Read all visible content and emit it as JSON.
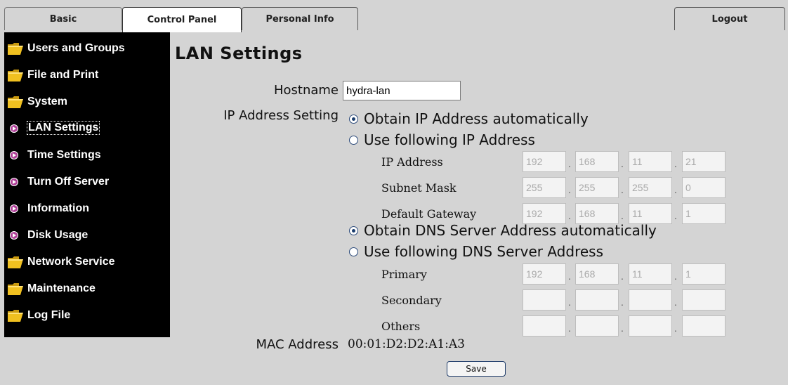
{
  "tabs": {
    "basic": "Basic",
    "control_panel": "Control Panel",
    "personal_info": "Personal Info",
    "logout": "Logout"
  },
  "sidebar": {
    "items": [
      {
        "label": "Users and Groups",
        "icon": "folder-icon"
      },
      {
        "label": "File and Print",
        "icon": "folder-icon"
      },
      {
        "label": "System",
        "icon": "folder-open-icon"
      },
      {
        "label": "LAN Settings",
        "icon": "arrow-bullet-icon"
      },
      {
        "label": "Time Settings",
        "icon": "arrow-bullet-icon"
      },
      {
        "label": "Turn Off Server",
        "icon": "arrow-bullet-icon"
      },
      {
        "label": "Information",
        "icon": "arrow-bullet-icon"
      },
      {
        "label": "Disk Usage",
        "icon": "arrow-bullet-icon"
      },
      {
        "label": "Network Service",
        "icon": "folder-icon"
      },
      {
        "label": "Maintenance",
        "icon": "folder-icon"
      },
      {
        "label": "Log File",
        "icon": "folder-icon"
      }
    ]
  },
  "main": {
    "title": "LAN Settings",
    "hostname_label": "Hostname",
    "hostname_value": "hydra-lan",
    "ip_setting_label": "IP Address Setting",
    "ip_options": [
      {
        "label": "Obtain IP Address automatically",
        "checked": true
      },
      {
        "label": "Use following IP Address",
        "checked": false
      }
    ],
    "ip_fields": [
      {
        "label": "IP Address",
        "octets": [
          "192",
          "168",
          "11",
          "21"
        ]
      },
      {
        "label": "Subnet Mask",
        "octets": [
          "255",
          "255",
          "255",
          "0"
        ]
      },
      {
        "label": "Default Gateway",
        "octets": [
          "192",
          "168",
          "11",
          "1"
        ]
      }
    ],
    "dns_options": [
      {
        "label": "Obtain DNS Server Address automatically",
        "checked": true
      },
      {
        "label": "Use following DNS Server Address",
        "checked": false
      }
    ],
    "dns_fields": [
      {
        "label": "Primary",
        "octets": [
          "192",
          "168",
          "11",
          "1"
        ]
      },
      {
        "label": "Secondary",
        "octets": [
          "",
          "",
          "",
          ""
        ]
      },
      {
        "label": "Others",
        "octets": [
          "",
          "",
          "",
          ""
        ]
      }
    ],
    "mac_label": "MAC Address",
    "mac_value": "00:01:D2:D2:A1:A3",
    "save_label": "Save"
  },
  "colors": {
    "background": "#d4d4d4",
    "sidebar_bg": "#000000",
    "folder_icon": "#f0c020",
    "arrow_icon": "#b04098"
  }
}
